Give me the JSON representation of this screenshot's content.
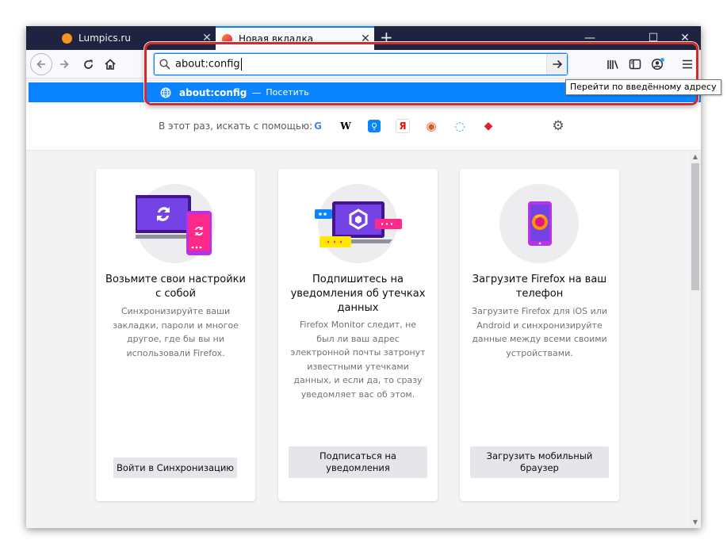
{
  "tabs": [
    {
      "title": "Lumpics.ru",
      "active": false
    },
    {
      "title": "Новая вкладка",
      "active": true
    }
  ],
  "new_tab_label": "+",
  "window_controls": {
    "minimize": "—",
    "maximize": "☐",
    "close": "✕"
  },
  "urlbar": {
    "value": "about:config"
  },
  "suggestion": {
    "text": "about:config",
    "dash": "—",
    "action": "Посетить"
  },
  "tooltip": "Перейти по введённому адресу",
  "search_providers": {
    "label": "В этот раз, искать с помощью:",
    "engines": [
      {
        "name": "google",
        "glyph": "G",
        "color": "#4285f4"
      },
      {
        "name": "wikipedia",
        "glyph": "W",
        "color": "#000000"
      },
      {
        "name": "search",
        "glyph": "⚲",
        "color": "#ffffff"
      },
      {
        "name": "yandex",
        "glyph": "Я",
        "color": "#e61400"
      },
      {
        "name": "duckduckgo",
        "glyph": "◉",
        "color": "#de5833"
      },
      {
        "name": "rambler",
        "glyph": "◌",
        "color": "#2aa7e0"
      },
      {
        "name": "mail",
        "glyph": "◆",
        "color": "#e0212e"
      }
    ]
  },
  "cards": [
    {
      "title": "Возьмите свои настройки с собой",
      "description": "Синхронизируйте ваши закладки, пароли и многое другое, где бы вы ни использовали Firefox.",
      "button": "Войти в Синхронизацию"
    },
    {
      "title": "Подпишитесь на уведомления об утечках данных",
      "description": "Firefox Monitor следит, не был ли ваш адрес электронной почты затронут известными утечками данных, и если да, то сразу уведомляет вас об этом.",
      "button": "Подписаться на уведомления"
    },
    {
      "title": "Загрузите Firefox на ваш телефон",
      "description": "Загрузите Firefox для iOS или Android и синхронизируйте данные между всеми своими устройствами.",
      "button": "Загрузить мобильный браузер"
    }
  ],
  "colors": {
    "accent": "#0a84ff",
    "highlight": "#d22b2b",
    "tab_strip": "#202340"
  }
}
